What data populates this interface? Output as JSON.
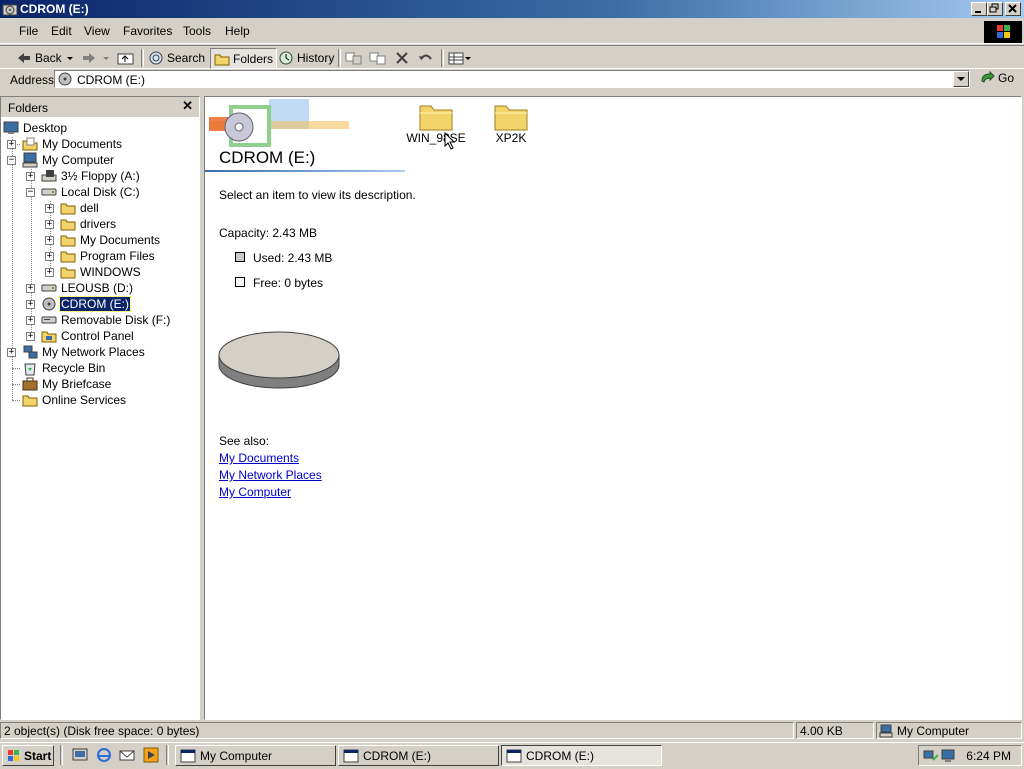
{
  "window": {
    "title": "CDROM (E:)"
  },
  "menu": [
    "File",
    "Edit",
    "View",
    "Favorites",
    "Tools",
    "Help"
  ],
  "toolbar": {
    "back": "Back",
    "search": "Search",
    "folders": "Folders",
    "history": "History"
  },
  "address": {
    "label": "Address",
    "value": "CDROM (E:)",
    "go": "Go"
  },
  "folders": {
    "header": "Folders",
    "tree": {
      "desktop": "Desktop",
      "my_documents": "My Documents",
      "my_computer": "My Computer",
      "floppy": "3½ Floppy (A:)",
      "local_disk": "Local Disk (C:)",
      "dell": "dell",
      "drivers": "drivers",
      "c_my_documents": "My Documents",
      "program_files": "Program Files",
      "windows": "WINDOWS",
      "leousb": "LEOUSB (D:)",
      "cdrom": "CDROM (E:)",
      "removable": "Removable Disk (F:)",
      "control_panel": "Control Panel",
      "network_places": "My Network Places",
      "recycle_bin": "Recycle Bin",
      "briefcase": "My Briefcase",
      "online_services": "Online Services"
    }
  },
  "content": {
    "drive_title": "CDROM (E:)",
    "description": "Select an item to view its description.",
    "capacity": "Capacity: 2.43 MB",
    "used": "Used: 2.43 MB",
    "free": "Free: 0 bytes",
    "see_also": "See also:",
    "links": [
      "My Documents",
      "My Network Places",
      "My Computer"
    ],
    "items": [
      "WIN_98SE",
      "XP2K"
    ]
  },
  "status": {
    "objects": "2 object(s) (Disk free space: 0 bytes)",
    "size": "4.00 KB",
    "zone": "My Computer"
  },
  "taskbar": {
    "start": "Start",
    "buttons": [
      "My Computer",
      "CDROM (E:)",
      "CDROM (E:)"
    ],
    "clock": "6:24 PM"
  },
  "colors": {
    "titlebar": "#0a246a",
    "selection": "#0a246a",
    "link": "#0000cc",
    "face": "#d4d0c8"
  }
}
